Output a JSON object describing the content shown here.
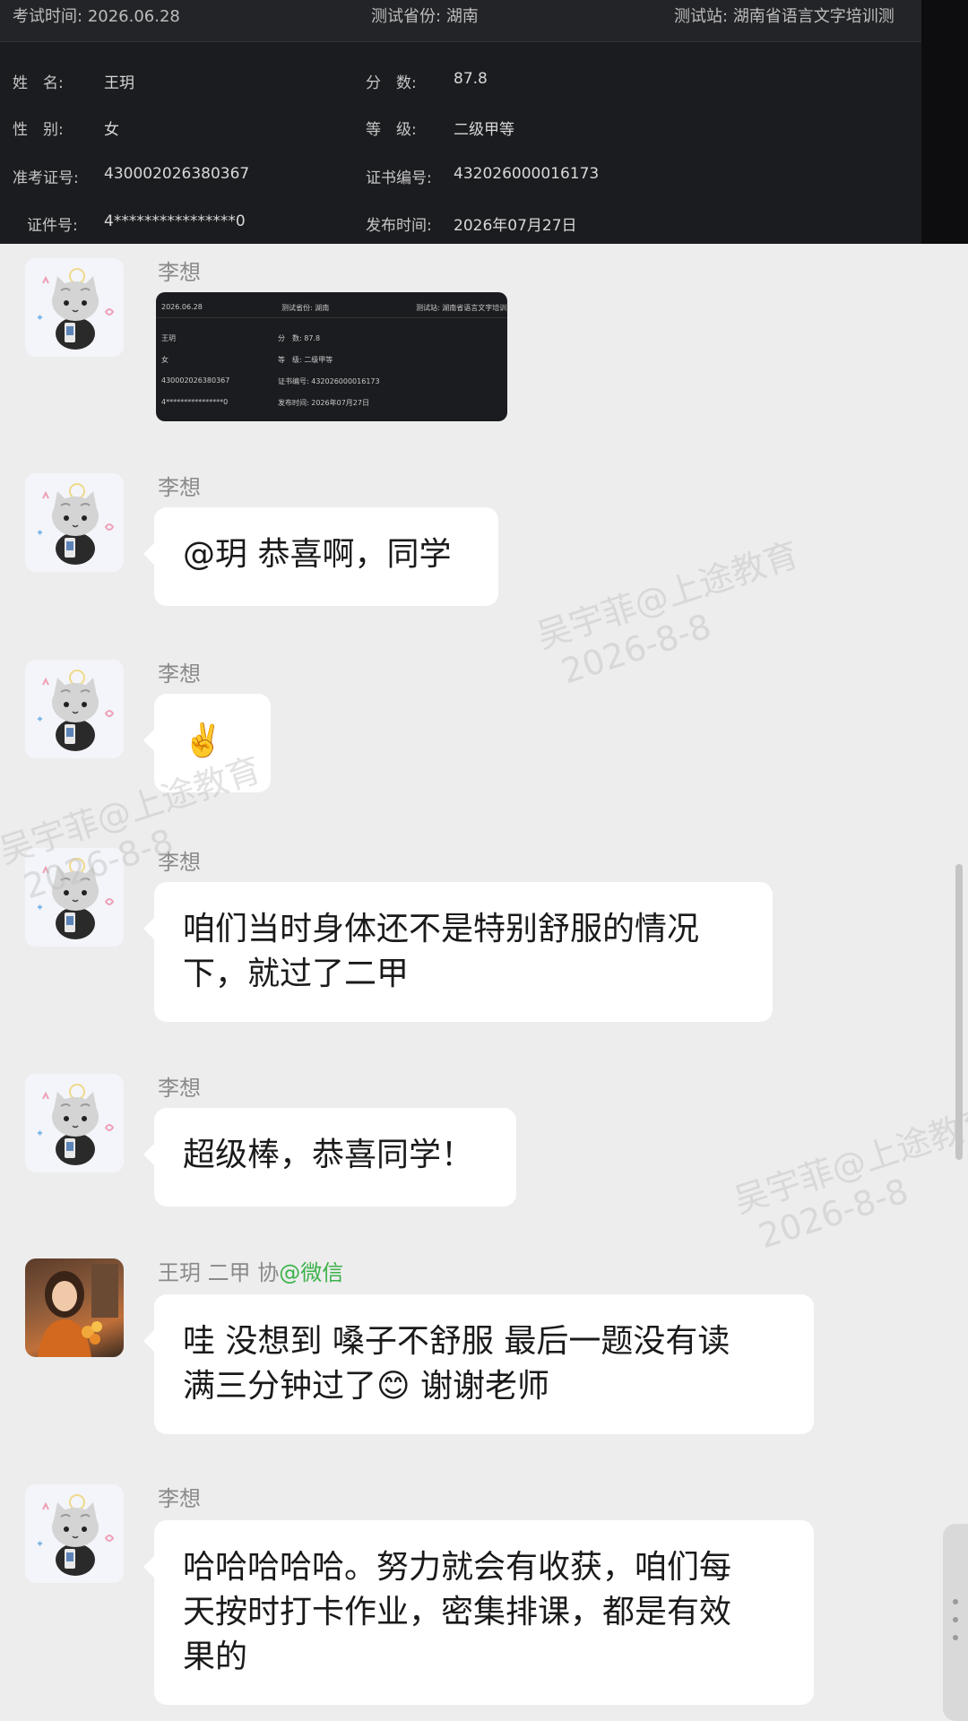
{
  "certificate": {
    "header": {
      "exam_time_label": "考试时间:",
      "exam_time": "2026.06.28",
      "province_label": "测试省份:",
      "province": "湖南",
      "station_label": "测试站:",
      "station": "湖南省语言文字培训测"
    },
    "fields": {
      "name_label": "姓　名:",
      "name": "王玥",
      "score_label": "分　数:",
      "score": "87.8",
      "gender_label": "性　别:",
      "gender": "女",
      "level_label": "等　级:",
      "level": "二级甲等",
      "ticket_label": "准考证号:",
      "ticket": "430002026380367",
      "cert_no_label": "证书编号:",
      "cert_no": "432026000016173",
      "id_label": "证件号:",
      "id": "4****************0",
      "publish_label": "发布时间:",
      "publish": "2026年07月27日"
    }
  },
  "thumbnail": {
    "date": "2026.06.28",
    "province_label": "测试省份:",
    "province": "湖南",
    "station_label": "测试站:",
    "station": "湖南省语言文字培训",
    "name": "王玥",
    "score_label": "分　数:",
    "score": "87.8",
    "gender": "女",
    "level_label": "等　级:",
    "level": "二级甲等",
    "ticket": "430002026380367",
    "cert_no_label": "证书编号:",
    "cert_no": "432026000016173",
    "id": "4****************0",
    "publish_label": "发布时间:",
    "publish": "2026年07月27日"
  },
  "messages": [
    {
      "sender": "李想",
      "type": "image"
    },
    {
      "sender": "李想",
      "text": "@玥 恭喜啊，同学"
    },
    {
      "sender": "李想",
      "text": "✌️"
    },
    {
      "sender": "李想",
      "lines": [
        "咱们当时身体还不是特别舒服的情况",
        "下，就过了二甲"
      ]
    },
    {
      "sender": "李想",
      "text": "超级棒，恭喜同学！"
    },
    {
      "sender": "王玥 二甲 协",
      "sender_suffix": "@微信",
      "lines": [
        "哇 没想到 嗓子不舒服 最后一题没有读",
        "满三分钟过了😊 谢谢老师"
      ]
    },
    {
      "sender": "李想",
      "lines": [
        "哈哈哈哈哈。努力就会有收获，咱们每",
        "天按时打卡作业，密集排课，都是有效",
        "果的"
      ]
    }
  ],
  "watermark": {
    "line1": "吴宇菲@上途教育",
    "line2": "2026-8-8"
  }
}
